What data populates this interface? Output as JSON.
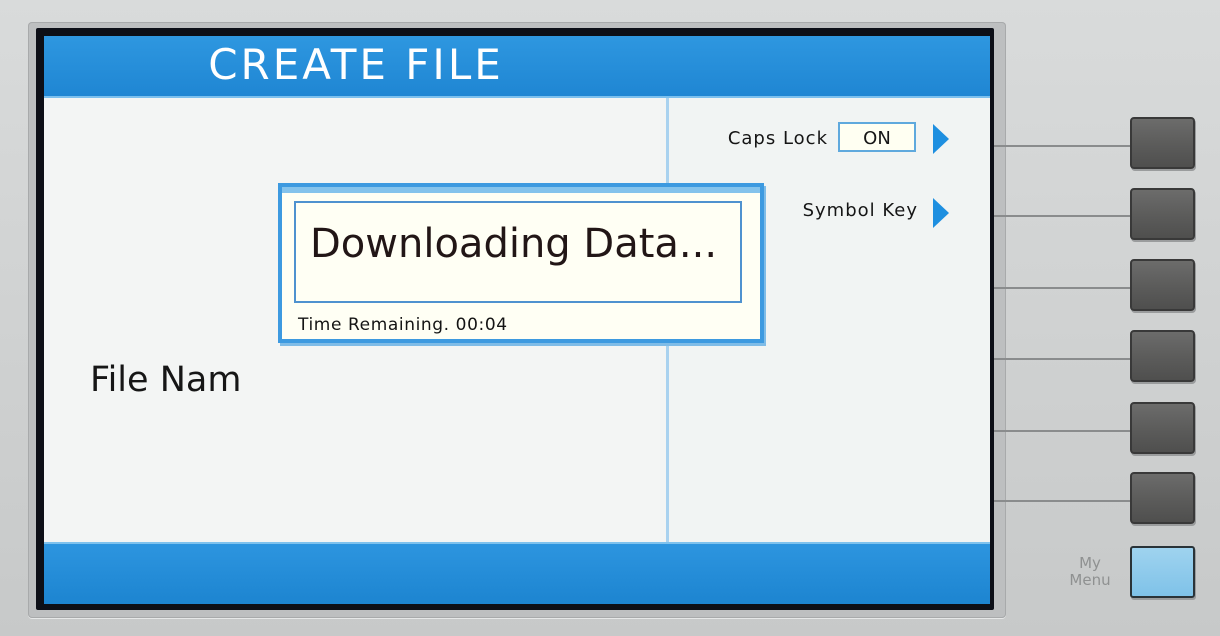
{
  "screen": {
    "title": "CREATE FILE",
    "field_label": "File Nam"
  },
  "softkeys": {
    "caps_lock": {
      "label": "Caps Lock",
      "value": "ON"
    },
    "symbol_key": {
      "label": "Symbol Key"
    }
  },
  "dialog": {
    "message": "Downloading Data...",
    "time_remaining": "Time Remaining. 00:04"
  },
  "hardware": {
    "my_menu_label_line1": "My",
    "my_menu_label_line2": "Menu"
  },
  "colors": {
    "accent_blue": "#1f86d3",
    "screen_background": "#eef1ef",
    "bezel": "#d1d3d3",
    "my_menu_button": "#86c8ea"
  },
  "icons": {
    "softkey_arrow": "right-triangle-icon"
  }
}
